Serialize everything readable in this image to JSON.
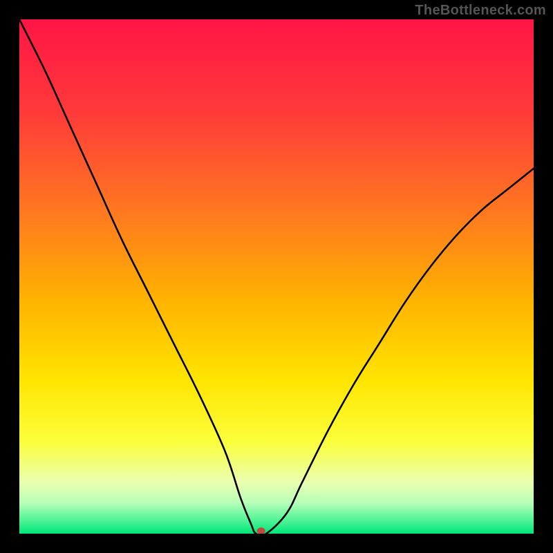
{
  "watermark": "TheBottleneck.com",
  "chart_data": {
    "type": "line",
    "title": "",
    "xlabel": "",
    "ylabel": "",
    "xlim": [
      0,
      100
    ],
    "ylim": [
      0,
      100
    ],
    "grid": false,
    "x": [
      0,
      5,
      10,
      15,
      20,
      25,
      30,
      35,
      40,
      43,
      45,
      46,
      48,
      52,
      55,
      60,
      65,
      70,
      75,
      80,
      85,
      90,
      95,
      100
    ],
    "values": [
      100,
      90,
      79,
      68,
      57,
      47,
      37,
      27,
      16,
      7,
      2,
      0,
      0,
      4,
      10,
      20,
      29,
      37,
      45,
      52,
      58,
      63,
      67,
      71
    ],
    "minimum_marker": {
      "x": 47,
      "y": 0
    },
    "background_gradient": {
      "stops": [
        {
          "offset": 0.0,
          "color": "#ff1546"
        },
        {
          "offset": 0.18,
          "color": "#ff3a3a"
        },
        {
          "offset": 0.38,
          "color": "#ff7a1f"
        },
        {
          "offset": 0.55,
          "color": "#ffb400"
        },
        {
          "offset": 0.7,
          "color": "#ffe400"
        },
        {
          "offset": 0.82,
          "color": "#fbff3a"
        },
        {
          "offset": 0.9,
          "color": "#eaffb0"
        },
        {
          "offset": 0.94,
          "color": "#b8ffb8"
        },
        {
          "offset": 0.97,
          "color": "#5cf59a"
        },
        {
          "offset": 1.0,
          "color": "#00e57a"
        }
      ]
    }
  }
}
